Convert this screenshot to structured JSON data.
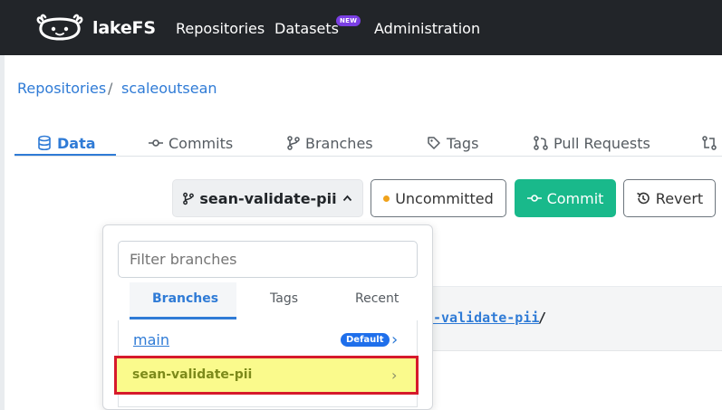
{
  "header": {
    "brand": "lakeFS",
    "nav": [
      {
        "label": "Repositories"
      },
      {
        "label": "Datasets",
        "badge": "NEW"
      },
      {
        "label": "Administration"
      }
    ]
  },
  "breadcrumb": {
    "root": "Repositories",
    "separator": "/",
    "repo": "scaleoutsean"
  },
  "tabs": [
    {
      "label": "Data",
      "icon": "database-icon",
      "active": true
    },
    {
      "label": "Commits",
      "icon": "commit-icon"
    },
    {
      "label": "Branches",
      "icon": "branch-icon"
    },
    {
      "label": "Tags",
      "icon": "tag-icon"
    },
    {
      "label": "Pull Requests",
      "icon": "pull-request-icon"
    }
  ],
  "actions": {
    "branch_selector": "sean-validate-pii",
    "uncommitted": "Uncommitted",
    "commit": "Commit",
    "revert": "Revert"
  },
  "path": {
    "link": "-validate-pii",
    "slash": "/"
  },
  "dropdown": {
    "filter_placeholder": "Filter branches",
    "tabs": [
      "Branches",
      "Tags",
      "Recent"
    ],
    "active_tab": "Branches",
    "items": [
      {
        "name": "main",
        "badge": "Default"
      },
      {
        "name": "sean-validate-pii",
        "highlighted": true
      }
    ]
  },
  "colors": {
    "topbar": "#222529",
    "link": "#2f7bd6",
    "commit": "#19b98b",
    "highlight_fill": "#fafa8c",
    "highlight_border": "#d61a2b",
    "badge_new": "#7b3fe4"
  }
}
